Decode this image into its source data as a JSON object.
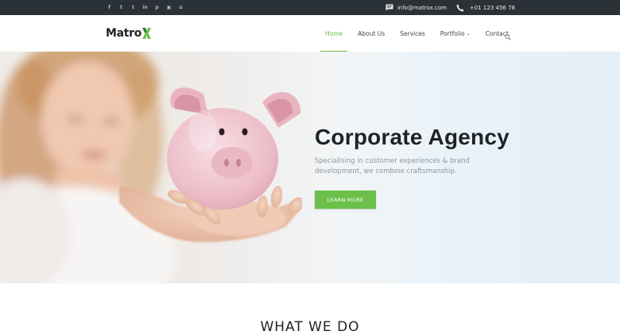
{
  "topbar": {
    "social_icons": [
      "facebook-icon",
      "twitter-icon",
      "tumblr-icon",
      "linkedin-icon",
      "pinterest-icon",
      "instagram-icon",
      "rss-icon"
    ],
    "social_glyphs": [
      "f",
      "t",
      "t",
      "in",
      "p",
      "▣",
      "≡"
    ],
    "email": "info@matrox.com",
    "phone": "+01 123 456 78"
  },
  "header": {
    "logo": "Matro",
    "nav": [
      {
        "label": "Home",
        "active": true
      },
      {
        "label": "About Us"
      },
      {
        "label": "Services"
      },
      {
        "label": "Portfolio",
        "caret": true
      },
      {
        "label": "Contact"
      }
    ]
  },
  "hero": {
    "title": "Corporate Agency",
    "subtitle": "Specialising in customer experiences & brand development, we combine craftsmanship.",
    "button": "LEARN MORE"
  },
  "section": {
    "title": "WHAT WE DO"
  },
  "colors": {
    "accent": "#6cc04a",
    "topbar": "#2b3237",
    "heading": "#1e2326"
  }
}
